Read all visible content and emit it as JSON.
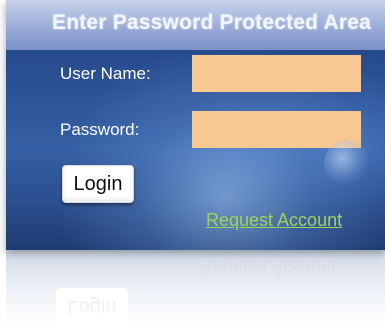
{
  "login_form": {
    "title": "Enter Password Protected Area",
    "username_label": "User Name:",
    "username_value": "",
    "password_label": "Password:",
    "password_value": "",
    "login_button_label": "Login",
    "request_account_link": "Request Account"
  },
  "colors": {
    "panel_background": "#2a4f93",
    "title_bar": "#aab9df",
    "input_background": "#f7c892",
    "link_color": "#9fd35a"
  },
  "icons": {
    "decorative_globe": "globe-icon"
  }
}
